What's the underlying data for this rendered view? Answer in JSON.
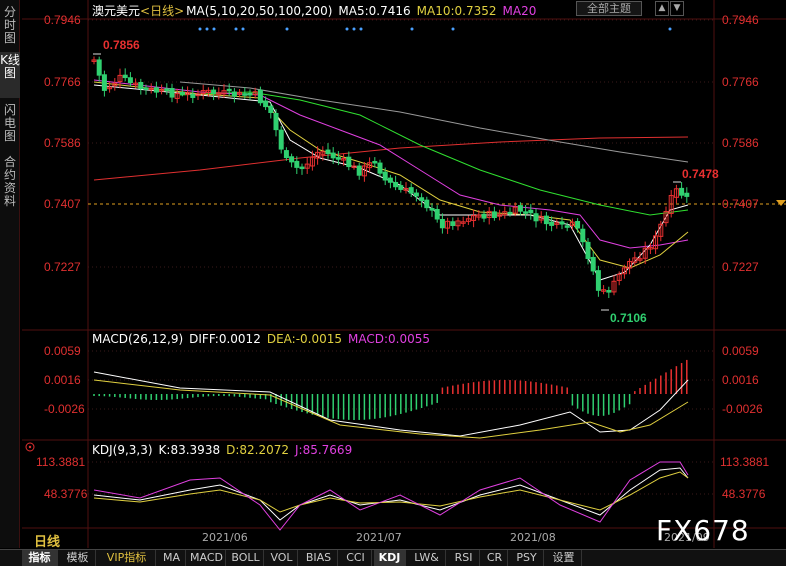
{
  "side_tabs": [
    "分时图",
    "K线图",
    "闪电图",
    "合约资料"
  ],
  "header": {
    "symbol": "澳元美元",
    "period_tag": "<日线>",
    "ma_label": "MA(5,10,20,50,100,200)",
    "ma5": "MA5:0.7416",
    "ma10": "MA10:0.7352",
    "ma20": "MA20",
    "dropdown": "全部主题",
    "arrows": [
      "▲",
      "▼"
    ]
  },
  "price_axis": {
    "left": [
      "0.7946",
      "0.7766",
      "0.7586",
      "0.7407",
      "0.7227"
    ],
    "right": [
      "0.7946",
      "0.7766",
      "0.7586",
      "0.7407",
      "0.7227"
    ]
  },
  "annotations": {
    "high": "0.7856",
    "low": "0.7106",
    "recent_high": "0.7478"
  },
  "macd": {
    "header": [
      "MACD(26,12,9)",
      "DIFF:0.0012",
      "DEA:-0.0015",
      "MACD:0.0055"
    ],
    "axis": [
      "0.0059",
      "0.0016",
      "-0.0026"
    ]
  },
  "kdj": {
    "header": [
      "KDJ(9,3,3)",
      "K:83.3938",
      "D:82.2072",
      "J:85.7669"
    ],
    "axis": [
      "113.3881",
      "48.3776"
    ]
  },
  "dates": [
    "2021/06",
    "2021/07",
    "2021/08",
    "2021/09"
  ],
  "period_label": "日线",
  "watermark": "FX678",
  "bottom_tabs": [
    "指标",
    "模板",
    "VIP指标",
    "MA",
    "MACD",
    "BOLL",
    "VOL",
    "BIAS",
    "CCI",
    "KDJ",
    "LW&",
    "RSI",
    "CR",
    "PSY",
    "设置"
  ],
  "colors": {
    "up": "#e83030",
    "down": "#30d070",
    "ma5": "#ffffff",
    "ma10": "#e0d040",
    "ma20": "#e040e0",
    "ma50": "#30e030",
    "ma100": "#999999",
    "ma200": "#e03030"
  }
}
